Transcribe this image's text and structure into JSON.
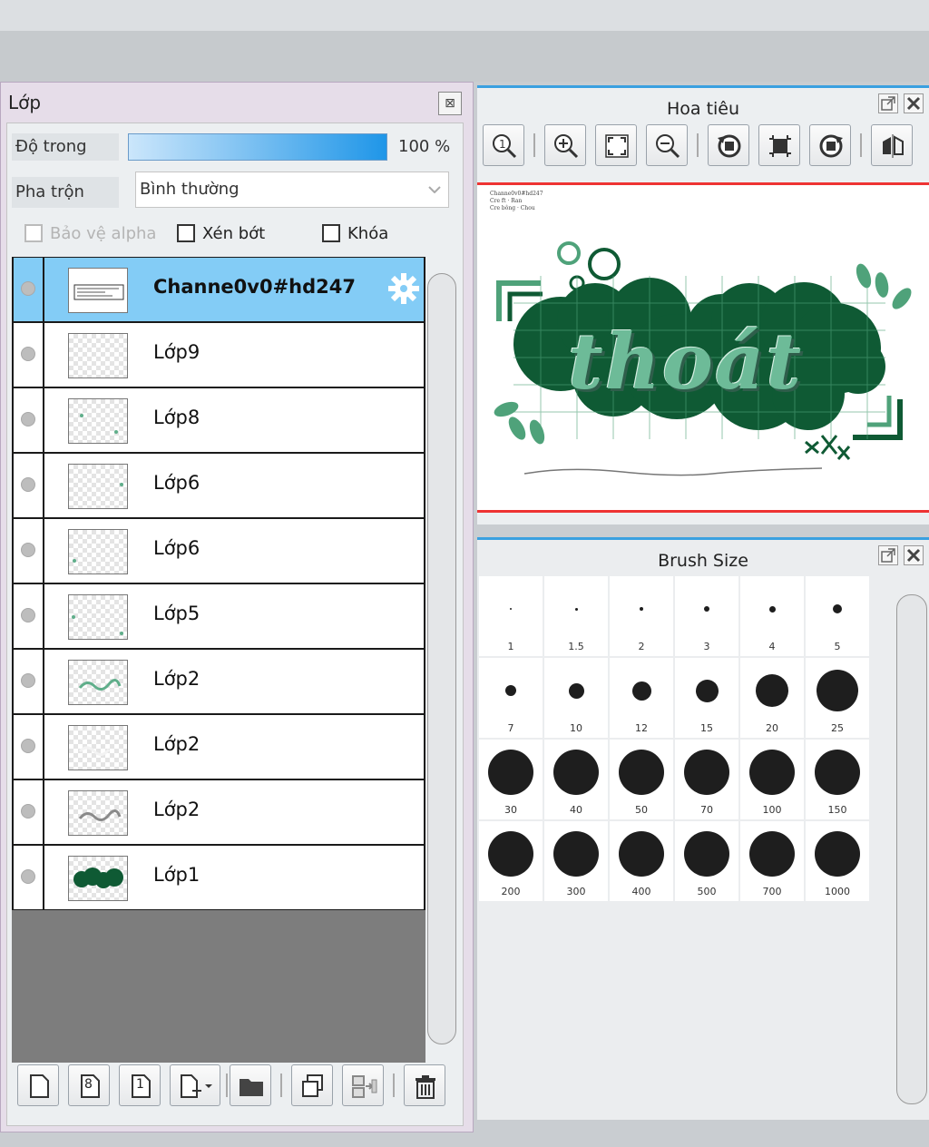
{
  "layer_panel": {
    "title": "Lớp",
    "close_label": "⊠",
    "opacity_label": "Độ trong",
    "opacity_value": "100 %",
    "opacity_percent": 100,
    "blend_label": "Pha trộn",
    "blend_value": "Bình thường",
    "protect_alpha": "Bảo vệ alpha",
    "clipping": "Xén bớt",
    "lock": "Khóa",
    "layers": [
      {
        "name": "Channe0v0#hd247",
        "selected": true
      },
      {
        "name": "Lớp9"
      },
      {
        "name": "Lớp8"
      },
      {
        "name": "Lớp6"
      },
      {
        "name": "Lớp6"
      },
      {
        "name": "Lớp5"
      },
      {
        "name": "Lớp2"
      },
      {
        "name": "Lớp2"
      },
      {
        "name": "Lớp2"
      },
      {
        "name": "Lớp1"
      }
    ],
    "toolbar": {
      "new_layer": "new-layer-icon",
      "new_8bit": "8",
      "new_1bit": "1",
      "add": "add-layer-icon",
      "folder": "folder-icon",
      "copy": "copy-layer-icon",
      "merge": "merge-down-icon",
      "delete": "trash-icon"
    }
  },
  "navigator": {
    "title": "Hoa tiêu",
    "artwork_text": "thoát",
    "credit_lines": [
      "Channe0v0#hd247",
      "Cre ft · Ran",
      "Cre bông · Chou"
    ]
  },
  "brush_panel": {
    "title": "Brush Size",
    "sizes": [
      "1",
      "1.5",
      "2",
      "3",
      "4",
      "5",
      "7",
      "10",
      "12",
      "15",
      "20",
      "25",
      "30",
      "40",
      "50",
      "70",
      "100",
      "150",
      "200",
      "300",
      "400",
      "500",
      "700",
      "1000"
    ]
  },
  "colors": {
    "selected_row": "#83ccf6",
    "accent": "#3aa0e0",
    "canvas_border": "#e33333",
    "art_green": "#0f5a34"
  }
}
